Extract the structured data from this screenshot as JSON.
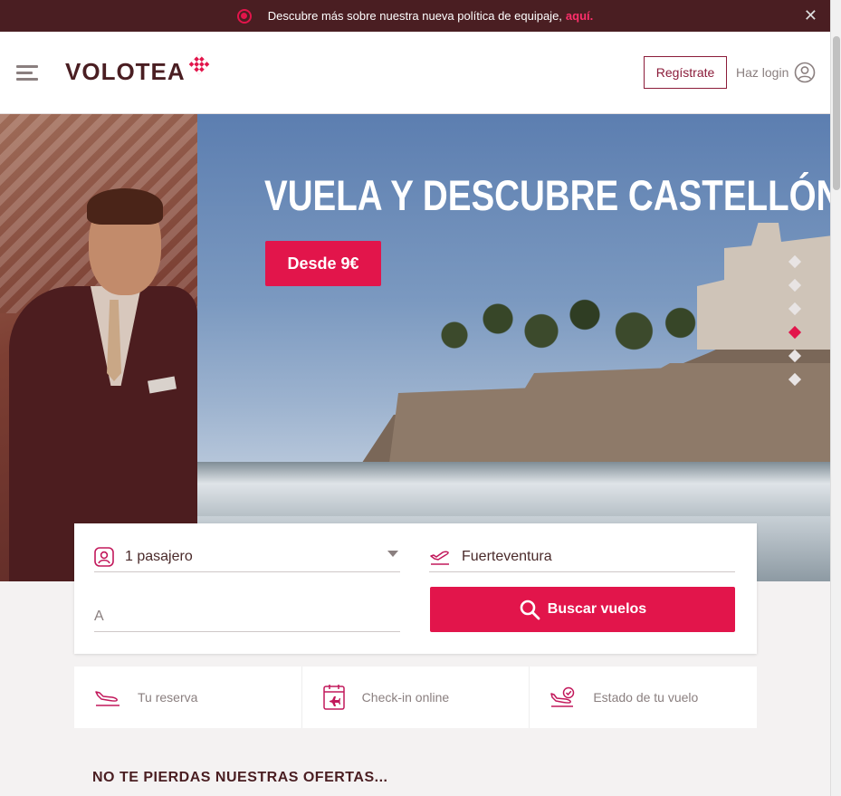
{
  "banner": {
    "text": "Descubre más sobre nuestra nueva política de equipaje,",
    "link": "aquí."
  },
  "header": {
    "logo_text": "VOLOTEA",
    "register_label": "Regístrate",
    "login_label": "Haz login"
  },
  "hero": {
    "title": "VUELA Y DESCUBRE CASTELLÓN",
    "cta_label": "Desde 9€",
    "slides_count": 6,
    "active_slide": 4
  },
  "search": {
    "passengers_value": "1 pasajero",
    "origin_value": "Fuerteventura",
    "destination_placeholder": "A",
    "search_button_label": "Buscar vuelos"
  },
  "quick_links": [
    {
      "label": "Tu reserva",
      "icon": "plane-landing-icon"
    },
    {
      "label": "Check-in online",
      "icon": "boarding-pass-icon"
    },
    {
      "label": "Estado de tu vuelo",
      "icon": "flight-status-icon"
    }
  ],
  "offers": {
    "title": "NO TE PIERDAS NUESTRAS OFERTAS..."
  },
  "colors": {
    "brand_dark": "#4a1e22",
    "accent": "#e2154b"
  }
}
